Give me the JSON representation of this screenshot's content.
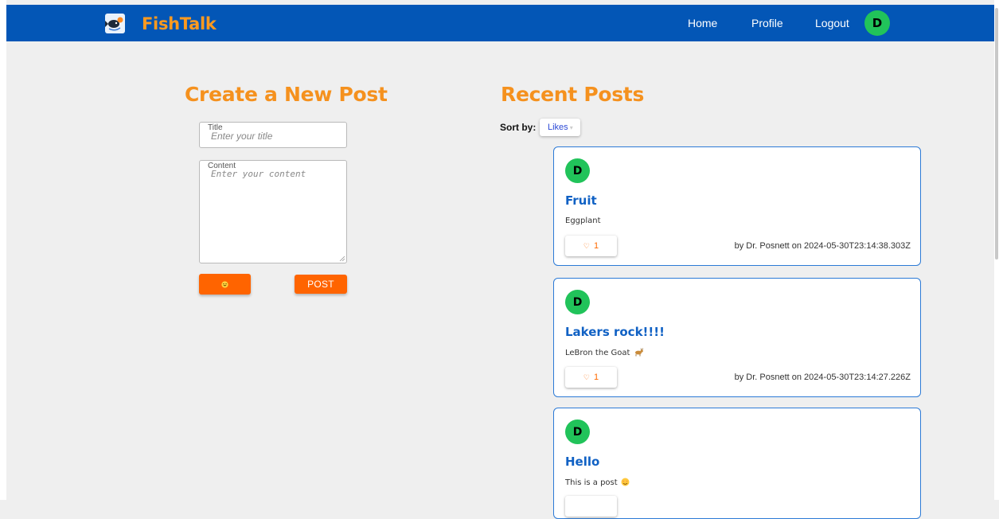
{
  "brand": {
    "name": "FishTalk",
    "logo_icon": "fish-logo-icon"
  },
  "nav": {
    "links": [
      "Home",
      "Profile",
      "Logout"
    ],
    "avatar_initial": "D"
  },
  "create": {
    "heading": "Create a New Post",
    "title_label": "Title",
    "title_placeholder": "Enter your title",
    "title_value": "",
    "content_label": "Content",
    "content_placeholder": "Enter your content",
    "content_value": "",
    "emoji_button_icon": "smiley-icon",
    "post_button": "POST"
  },
  "recent": {
    "heading": "Recent Posts",
    "sort_label": "Sort by:",
    "sort_value": "Likes",
    "posts": [
      {
        "avatar": "D",
        "title": "Fruit",
        "content": "Eggplant",
        "emoji": "",
        "likes": "1",
        "meta": "by Dr. Posnett on 2024-05-30T23:14:38.303Z"
      },
      {
        "avatar": "D",
        "title": "Lakers rock!!!!",
        "content": "LeBron the Goat",
        "emoji": "goat",
        "likes": "1",
        "meta": "by Dr. Posnett on 2024-05-30T23:14:27.226Z"
      },
      {
        "avatar": "D",
        "title": "Hello",
        "content": "This is a post",
        "emoji": "heart-face",
        "likes": "",
        "meta": ""
      }
    ]
  },
  "colors": {
    "navbar": "#0356b6",
    "brand": "#ff9a1f",
    "heading": "#f5911e",
    "button": "#ff6400",
    "avatar": "#21c35a",
    "post_title": "#1061c4",
    "card_border": "#2c7ad6",
    "background": "#efefef"
  }
}
